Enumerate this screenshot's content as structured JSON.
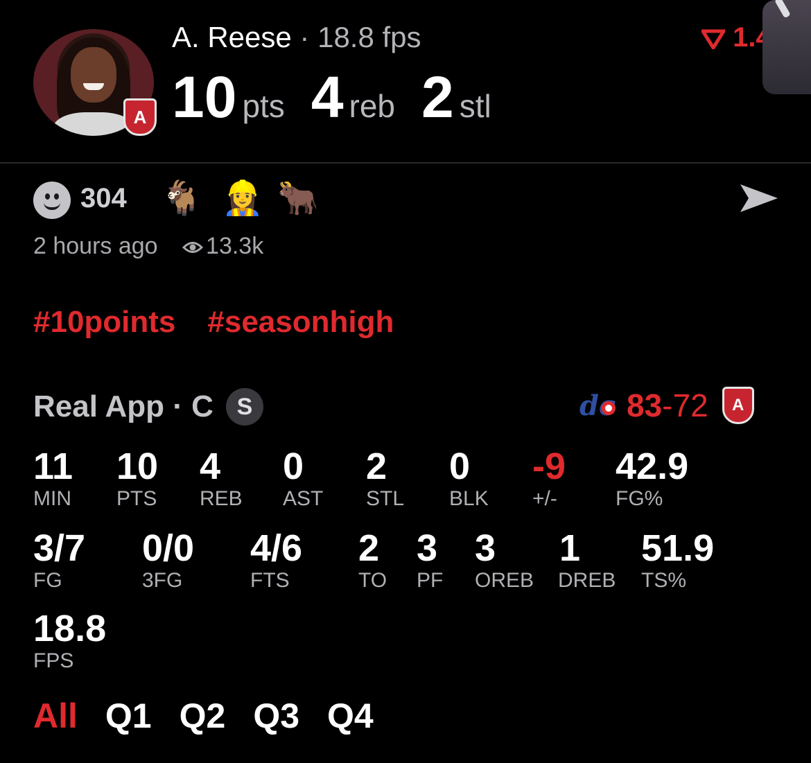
{
  "header": {
    "player_name": "A. Reese",
    "separator": " · ",
    "fps_text": "18.8 fps",
    "headline_stats": [
      {
        "value": "10",
        "unit": "pts"
      },
      {
        "value": "4",
        "unit": "reb"
      },
      {
        "value": "2",
        "unit": "stl"
      }
    ],
    "trend_text": "1.4",
    "team_badge_letter": "A"
  },
  "reactions": {
    "count": "304",
    "emojis": [
      "🐐",
      "👷‍♀️",
      "🐂"
    ],
    "time_ago": "2 hours ago",
    "views": "13.3k"
  },
  "tags": [
    "#10points",
    "#seasonhigh"
  ],
  "game": {
    "source": "Real App · C",
    "badge": "S",
    "score_winner": "83",
    "score_dash": "-",
    "score_loser": "72",
    "opponent_logo_text": "dc"
  },
  "stats_row1": [
    {
      "value": "11",
      "label": "MIN"
    },
    {
      "value": "10",
      "label": "PTS"
    },
    {
      "value": "4",
      "label": "REB"
    },
    {
      "value": "0",
      "label": "AST"
    },
    {
      "value": "2",
      "label": "STL"
    },
    {
      "value": "0",
      "label": "BLK"
    },
    {
      "value": "-9",
      "label": "+/-"
    },
    {
      "value": "42.9",
      "label": "FG%"
    }
  ],
  "stats_row2": [
    {
      "value": "3/7",
      "label": "FG"
    },
    {
      "value": "0/0",
      "label": "3FG"
    },
    {
      "value": "4/6",
      "label": "FTS"
    },
    {
      "value": "2",
      "label": "TO"
    },
    {
      "value": "3",
      "label": "PF"
    },
    {
      "value": "3",
      "label": "OREB"
    },
    {
      "value": "1",
      "label": "DREB"
    },
    {
      "value": "51.9",
      "label": "TS%"
    }
  ],
  "stats_row3": [
    {
      "value": "18.8",
      "label": "FPS"
    }
  ],
  "quarters": [
    "All",
    "Q1",
    "Q2",
    "Q3",
    "Q4"
  ],
  "colors": {
    "accent": "#e02a2e",
    "background": "#000000",
    "muted": "#b0b0b5"
  }
}
